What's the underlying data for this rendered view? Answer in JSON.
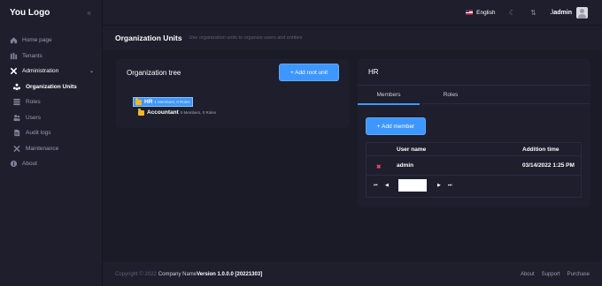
{
  "brand": {
    "logo": "You Logo"
  },
  "sidebar": {
    "items": [
      {
        "label": "Home page",
        "icon": "home-icon"
      },
      {
        "label": "Tenants",
        "icon": "grid-icon"
      },
      {
        "label": "Administration",
        "icon": "tools-icon",
        "expanded": true
      },
      {
        "label": "Organization Units",
        "icon": "org-units-icon",
        "active": true
      },
      {
        "label": "Roles",
        "icon": "roles-icon"
      },
      {
        "label": "Users",
        "icon": "users-icon"
      },
      {
        "label": "Audit logs",
        "icon": "file-icon"
      },
      {
        "label": "Maintenance",
        "icon": "wrench-icon"
      },
      {
        "label": "About",
        "icon": "info-icon"
      }
    ]
  },
  "topbar": {
    "language": "English",
    "username": ".\\admin"
  },
  "page": {
    "title": "Organization Units",
    "description": "Use organization units to organize users and entities"
  },
  "tree": {
    "title": "Organization tree",
    "add_root_label": "+ Add root unit",
    "nodes": [
      {
        "name": "HR",
        "meta": "1 Members, 0 Roles",
        "selected": true
      },
      {
        "name": "Accountant",
        "meta": "0 Members, 0 Roles"
      }
    ]
  },
  "detail": {
    "title": "HR",
    "tabs": [
      "Members",
      "Roles"
    ],
    "add_member_label": "+ Add member",
    "columns": [
      "User name",
      "Addition time"
    ],
    "rows": [
      {
        "user_name": "admin",
        "addition_time": "03/14/2022 1:25 PM"
      }
    ],
    "pager": {
      "first": "⏮",
      "prev": "◀",
      "next": "▶",
      "last": "⏭"
    }
  },
  "footer": {
    "copyright": "Copyright © 2022",
    "company": "Company Name",
    "version": "Version 1.0.0.0 [20221303]",
    "links": [
      "About",
      "Support",
      "Purchase"
    ]
  },
  "colors": {
    "accent": "#3e97ff",
    "danger": "#f1416c",
    "folder": "#f5b920"
  }
}
